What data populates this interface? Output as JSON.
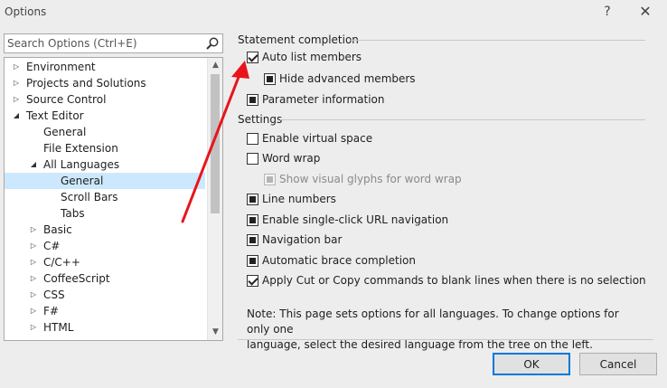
{
  "window": {
    "title": "Options",
    "help_label": "?",
    "close_label": "✕"
  },
  "search": {
    "placeholder": "Search Options (Ctrl+E)",
    "icon": "search-icon"
  },
  "tree": {
    "items": [
      {
        "label": "Environment",
        "arrow": "▷"
      },
      {
        "label": "Projects and Solutions",
        "arrow": "▷"
      },
      {
        "label": "Source Control",
        "arrow": "▷"
      },
      {
        "label": "Text Editor",
        "arrow": "◢"
      },
      {
        "label": "General",
        "arrow": ""
      },
      {
        "label": "File Extension",
        "arrow": ""
      },
      {
        "label": "All Languages",
        "arrow": "◢"
      },
      {
        "label": "General",
        "arrow": "",
        "selected": true
      },
      {
        "label": "Scroll Bars",
        "arrow": ""
      },
      {
        "label": "Tabs",
        "arrow": ""
      },
      {
        "label": "Basic",
        "arrow": "▷"
      },
      {
        "label": "C#",
        "arrow": "▷"
      },
      {
        "label": "C/C++",
        "arrow": "▷"
      },
      {
        "label": "CoffeeScript",
        "arrow": "▷"
      },
      {
        "label": "CSS",
        "arrow": "▷"
      },
      {
        "label": "F#",
        "arrow": "▷"
      },
      {
        "label": "HTML",
        "arrow": "▷"
      }
    ]
  },
  "statement_completion": {
    "header": "Statement completion",
    "auto_list_members": {
      "label": "Auto list members",
      "state": "checked"
    },
    "hide_advanced_members": {
      "label": "Hide advanced members",
      "state": "mixed"
    },
    "parameter_information": {
      "label": "Parameter information",
      "state": "mixed"
    }
  },
  "settings": {
    "header": "Settings",
    "enable_virtual_space": {
      "label": "Enable virtual space",
      "state": "unchecked"
    },
    "word_wrap": {
      "label": "Word wrap",
      "state": "unchecked"
    },
    "show_visual_glyphs": {
      "label": "Show visual glyphs for word wrap",
      "state": "mixed",
      "enabled": false
    },
    "line_numbers": {
      "label": "Line numbers",
      "state": "mixed"
    },
    "single_click_url": {
      "label": "Enable single-click URL navigation",
      "state": "mixed"
    },
    "navigation_bar": {
      "label": "Navigation bar",
      "state": "mixed"
    },
    "auto_brace": {
      "label": "Automatic brace completion",
      "state": "mixed"
    },
    "apply_cut_copy": {
      "label": "Apply Cut or Copy commands to blank lines when there is no selection",
      "state": "checked"
    }
  },
  "note": {
    "line1": "Note: This page sets options for all languages. To change options for only one",
    "line2": "language, select the desired language from the tree on the left."
  },
  "buttons": {
    "ok": "OK",
    "cancel": "Cancel"
  },
  "colors": {
    "selection": "#cce8ff",
    "accent": "#0078d7",
    "annotation_arrow": "#e8141c"
  }
}
